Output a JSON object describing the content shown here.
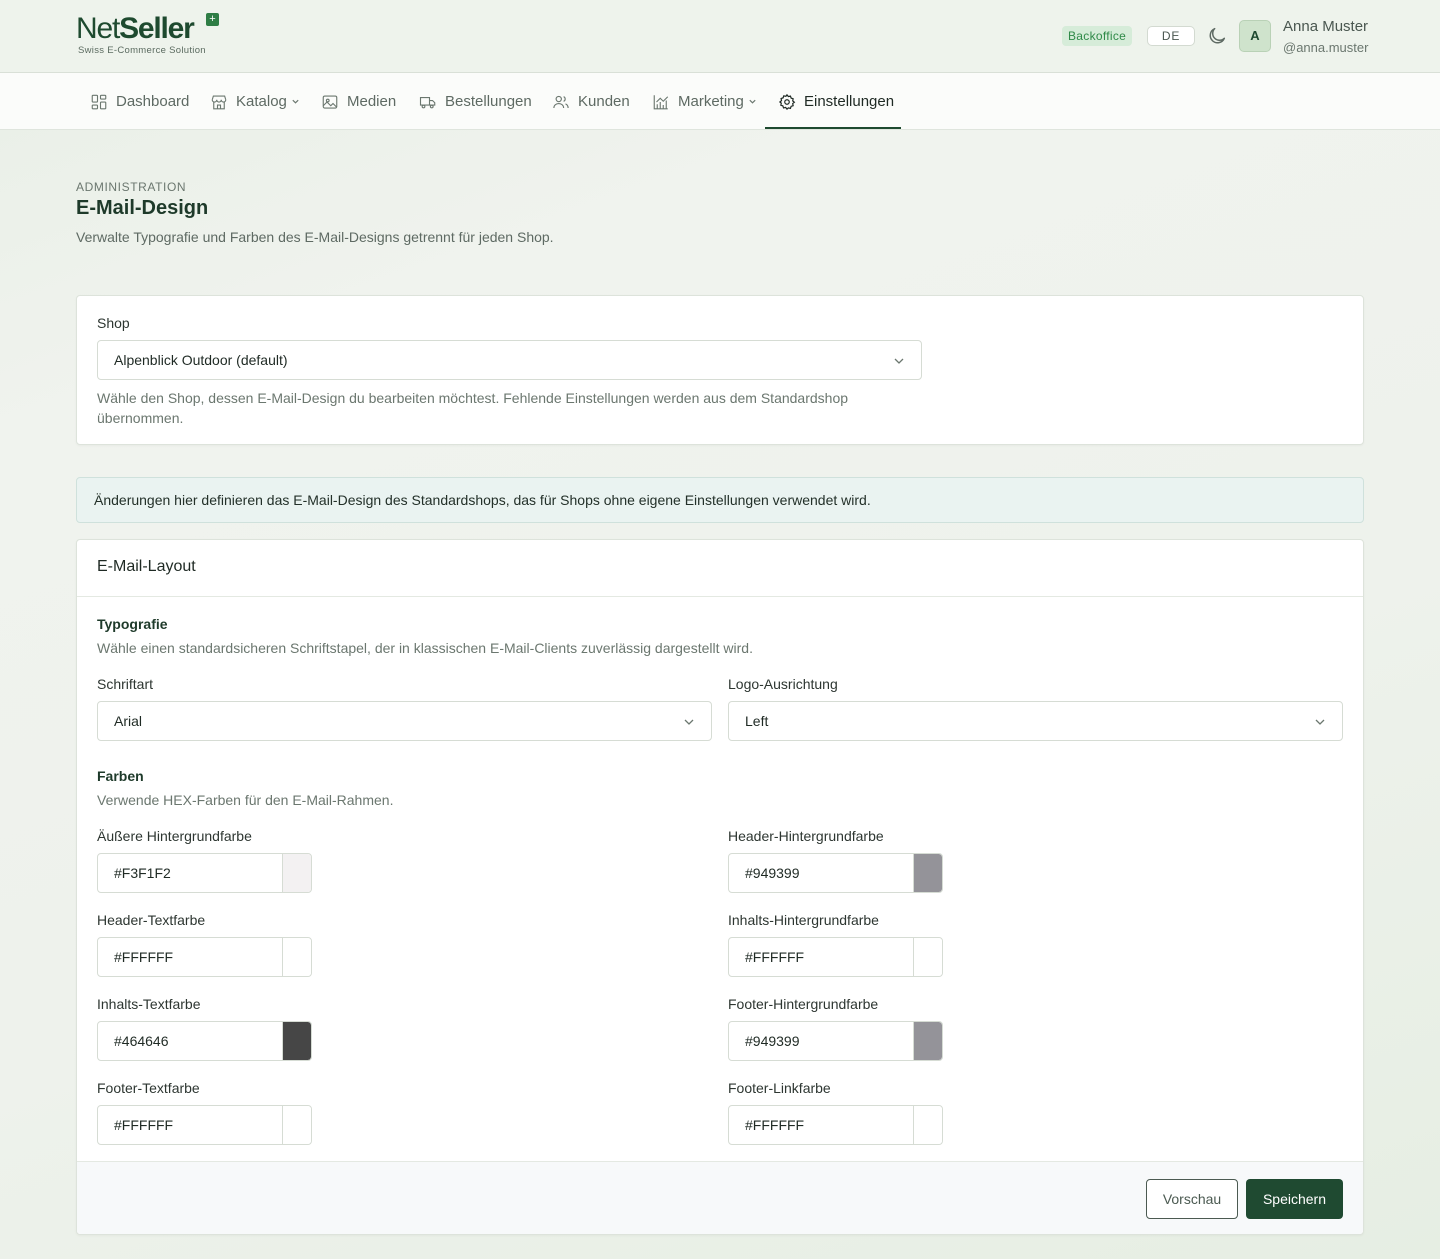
{
  "brand": {
    "name_light": "Net",
    "name_bold": "Seller",
    "tagline": "Swiss E-Commerce Solution",
    "color": "#1e4a2f"
  },
  "header": {
    "badge": "Backoffice",
    "language": "DE",
    "theme_icon": "moon-icon",
    "avatar_initial": "A",
    "user_name": "Anna Muster",
    "user_handle": "@anna.muster"
  },
  "nav": {
    "items": [
      {
        "label": "Dashboard",
        "icon": "dashboard-icon"
      },
      {
        "label": "Katalog",
        "icon": "store-icon",
        "has_dropdown": true
      },
      {
        "label": "Medien",
        "icon": "image-icon"
      },
      {
        "label": "Bestellungen",
        "icon": "truck-icon"
      },
      {
        "label": "Kunden",
        "icon": "users-icon"
      },
      {
        "label": "Marketing",
        "icon": "chart-icon",
        "has_dropdown": true
      },
      {
        "label": "Einstellungen",
        "icon": "gear-icon",
        "active": true
      }
    ]
  },
  "page": {
    "eyebrow": "ADMINISTRATION",
    "title": "E-Mail-Design",
    "description": "Verwalte Typografie und Farben des E-Mail-Designs getrennt für jeden Shop."
  },
  "shop_card": {
    "label": "Shop",
    "selected": "Alpenblick Outdoor (default)",
    "help": "Wähle den Shop, dessen E-Mail-Design du bearbeiten möchtest. Fehlende Einstellungen werden aus dem Standardshop übernommen."
  },
  "info": "Änderungen hier definieren das E-Mail-Design des Standardshops, das für Shops ohne eigene Einstellungen verwendet wird.",
  "layout_card": {
    "title": "E-Mail-Layout",
    "typography": {
      "title": "Typografie",
      "description": "Wähle einen standardsicheren Schriftstapel, der in klassischen E-Mail-Clients zuverlässig dargestellt wird.",
      "font_label": "Schriftart",
      "font_value": "Arial",
      "logo_label": "Logo-Ausrichtung",
      "logo_value": "Left"
    },
    "colors": {
      "title": "Farben",
      "description": "Verwende HEX-Farben für den E-Mail-Rahmen.",
      "fields": [
        {
          "label": "Äußere Hintergrundfarbe",
          "value": "#F3F1F2"
        },
        {
          "label": "Header-Hintergrundfarbe",
          "value": "#949399"
        },
        {
          "label": "Header-Textfarbe",
          "value": "#FFFFFF"
        },
        {
          "label": "Inhalts-Hintergrundfarbe",
          "value": "#FFFFFF"
        },
        {
          "label": "Inhalts-Textfarbe",
          "value": "#464646"
        },
        {
          "label": "Footer-Hintergrundfarbe",
          "value": "#949399"
        },
        {
          "label": "Footer-Textfarbe",
          "value": "#FFFFFF"
        },
        {
          "label": "Footer-Linkfarbe",
          "value": "#FFFFFF"
        }
      ]
    },
    "actions": {
      "preview": "Vorschau",
      "save": "Speichern"
    }
  }
}
